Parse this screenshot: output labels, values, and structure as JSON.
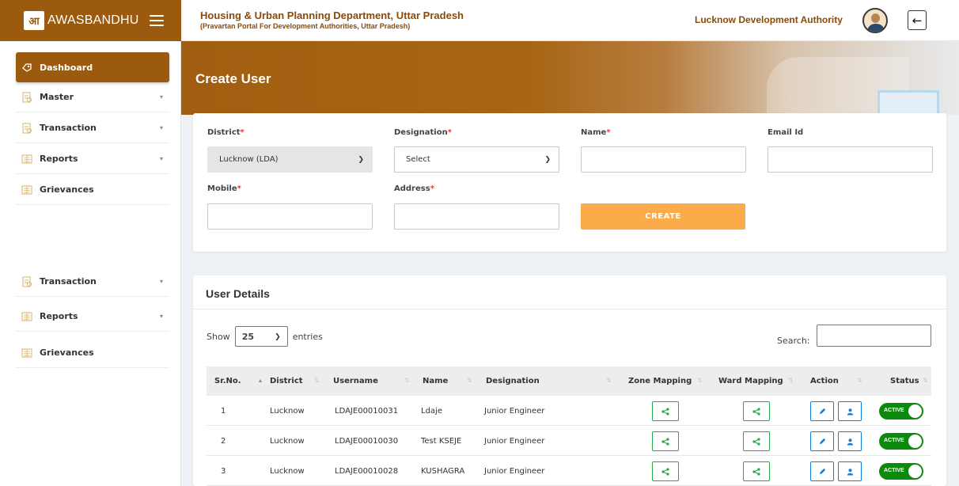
{
  "header": {
    "brand_logo_text": "आ",
    "brand_name": "AWASBANDHU",
    "department_title": "Housing & Urban Planning Department, Uttar Pradesh",
    "department_subtitle": "(Pravartan Portal For Development Authorities, Uttar Pradesh)",
    "organization": "Lucknow Development Authority",
    "back_icon": "←"
  },
  "sidebar": {
    "items": [
      {
        "label": "Dashboard",
        "icon": "dashboard-icon",
        "active": true,
        "has_caret": false
      },
      {
        "label": "Master",
        "icon": "document-icon",
        "has_caret": true
      },
      {
        "label": "Transaction",
        "icon": "document-icon",
        "has_caret": true
      },
      {
        "label": "Reports",
        "icon": "reports-icon",
        "has_caret": true
      },
      {
        "label": "Grievances",
        "icon": "reports-icon",
        "has_caret": false
      },
      {
        "label": "Transaction",
        "icon": "document-icon",
        "has_caret": true
      },
      {
        "label": "Reports",
        "icon": "reports-icon",
        "has_caret": true
      },
      {
        "label": "Grievances",
        "icon": "reports-icon",
        "has_caret": false
      }
    ]
  },
  "page": {
    "title": "Create User"
  },
  "form": {
    "district": {
      "label": "District",
      "value": "Lucknow (LDA)"
    },
    "designation": {
      "label": "Designation",
      "value": "Select"
    },
    "name": {
      "label": "Name",
      "value": ""
    },
    "email": {
      "label": "Email Id",
      "value": ""
    },
    "mobile": {
      "label": "Mobile",
      "value": ""
    },
    "address": {
      "label": "Address",
      "value": ""
    },
    "required_mark": "*",
    "create_label": "CREATE"
  },
  "users": {
    "title": "User Details",
    "show_label": "Show",
    "entries_value": "25",
    "entries_label": "entries",
    "search_label": "Search:",
    "columns": [
      "Sr.No.",
      "District",
      "Username",
      "Name",
      "Designation",
      "Zone Mapping",
      "Ward Mapping",
      "Action",
      "Status"
    ],
    "rows": [
      {
        "sr": "1",
        "district": "Lucknow",
        "username": "LDAJE00010031",
        "name": "Ldaje",
        "designation": "Junior Engineer",
        "status": "ACTIVE"
      },
      {
        "sr": "2",
        "district": "Lucknow",
        "username": "LDAJE00010030",
        "name": "Test KSEJE",
        "designation": "Junior Engineer",
        "status": "ACTIVE"
      },
      {
        "sr": "3",
        "district": "Lucknow",
        "username": "LDAJE00010028",
        "name": "KUSHAGRA",
        "designation": "Junior Engineer",
        "status": "ACTIVE"
      }
    ]
  },
  "colors": {
    "brand": "#9b5a0e",
    "create_button": "#fbab4a",
    "mapping_green": "#28a745",
    "action_blue": "#0d7fe0",
    "status_green": "#0b8a0b"
  }
}
